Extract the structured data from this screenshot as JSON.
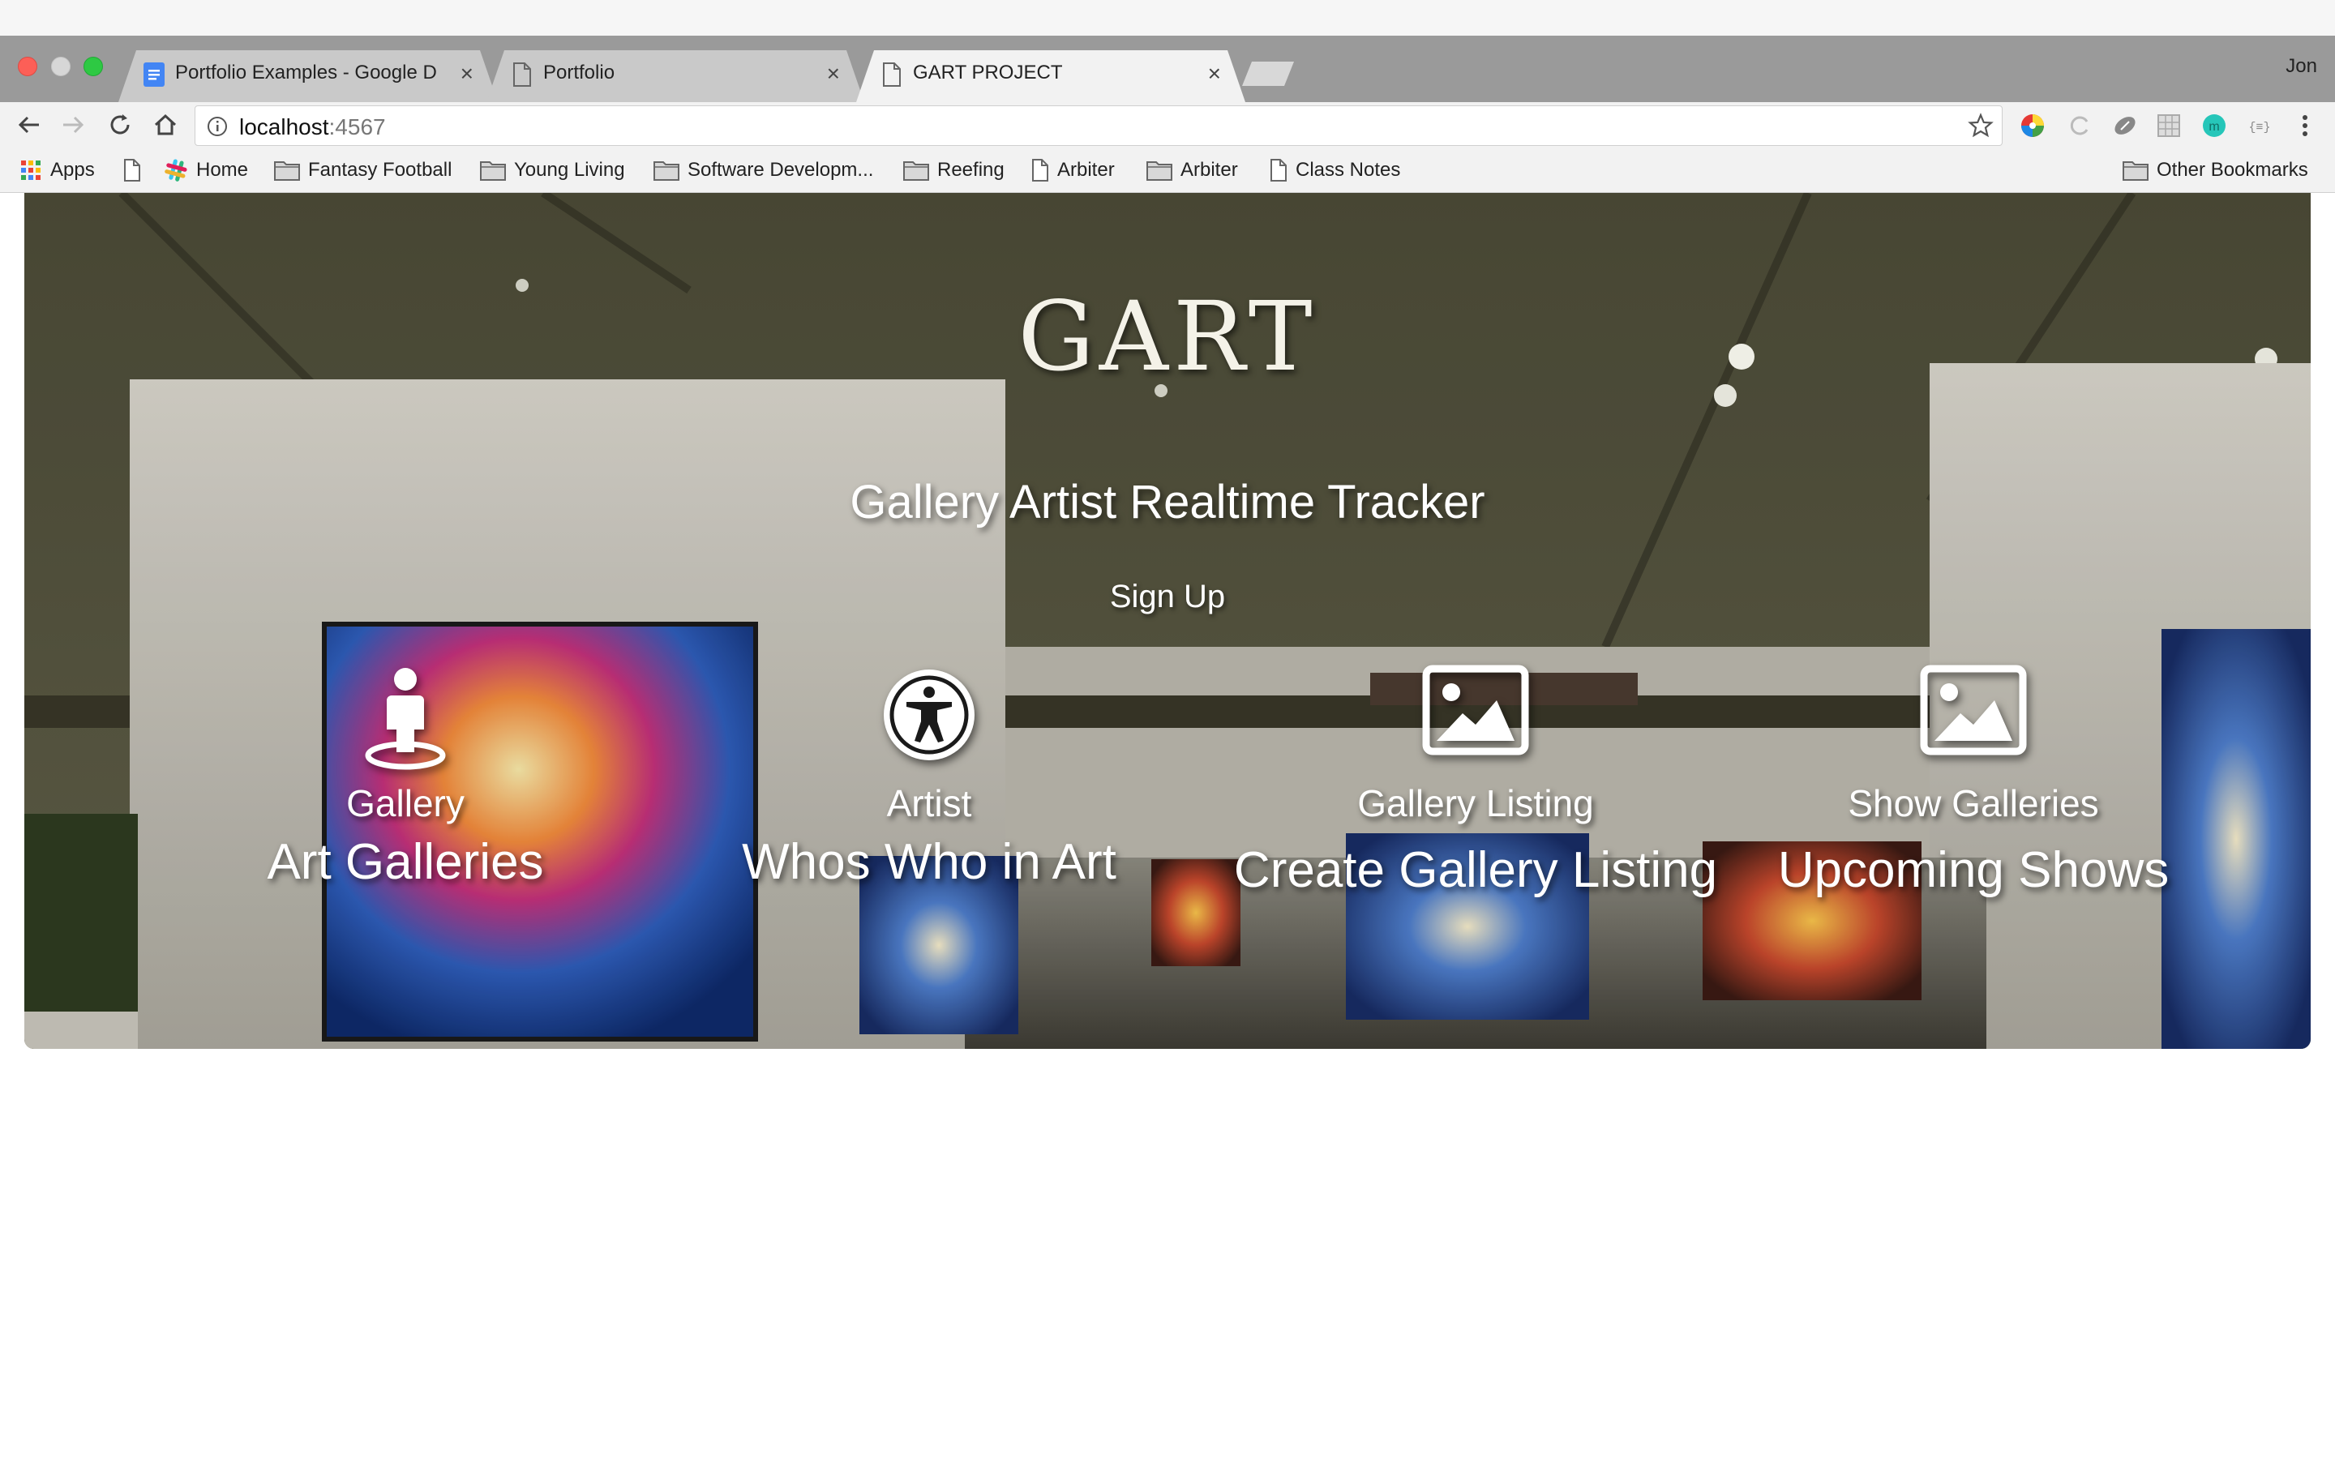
{
  "browser": {
    "tabs": [
      {
        "title": "Portfolio Examples - Google D",
        "active": false,
        "favicon": "google-docs-icon"
      },
      {
        "title": "Portfolio",
        "active": false,
        "favicon": "document-icon"
      },
      {
        "title": "GART PROJECT",
        "active": true,
        "favicon": "document-icon"
      }
    ],
    "profile_name": "Jon",
    "address": {
      "host": "localhost",
      "port": ":4567"
    },
    "bookmarks": [
      {
        "label": "Apps",
        "icon": "apps-grid-icon"
      },
      {
        "label": "",
        "icon": "page-icon"
      },
      {
        "label": "Home",
        "icon": "slack-icon"
      },
      {
        "label": "Fantasy Football",
        "icon": "folder-icon"
      },
      {
        "label": "Young Living",
        "icon": "folder-icon"
      },
      {
        "label": "Software Developm...",
        "icon": "folder-icon"
      },
      {
        "label": "Reefing",
        "icon": "folder-icon"
      },
      {
        "label": "Arbiter",
        "icon": "page-icon"
      },
      {
        "label": "Arbiter",
        "icon": "folder-icon"
      },
      {
        "label": "Class Notes",
        "icon": "page-icon"
      }
    ],
    "other_bookmarks": "Other Bookmarks"
  },
  "page": {
    "brand": "GART",
    "tagline": "Gallery Artist Realtime Tracker",
    "signup_label": "Sign Up",
    "features": [
      {
        "title": "Gallery",
        "subtitle": "Art Galleries",
        "icon": "street-view-icon"
      },
      {
        "title": "Artist",
        "subtitle": "Whos Who in Art",
        "icon": "accessibility-icon"
      },
      {
        "title": "Gallery Listing",
        "subtitle": "Create Gallery Listing",
        "icon": "picture-icon"
      },
      {
        "title": "Show Galleries",
        "subtitle": "Upcoming Shows",
        "icon": "picture-icon"
      }
    ]
  },
  "colors": {
    "tabstrip": "#9a9a9a",
    "toolbar": "#f2f2f2",
    "hero_wall": "#6d6c56"
  }
}
